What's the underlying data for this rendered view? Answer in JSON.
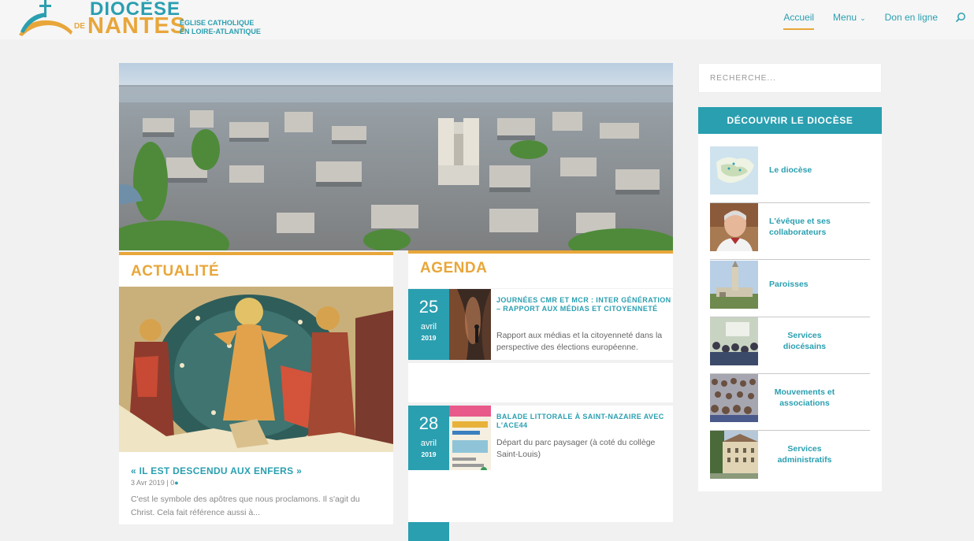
{
  "header": {
    "logo_line1": "DIOCÈSE",
    "logo_de": "DE",
    "logo_line2": "NANTES",
    "logo_sub1": "ÉGLISE CATHOLIQUE",
    "logo_sub2": "EN LOIRE-ATLANTIQUE",
    "nav": {
      "home": "Accueil",
      "menu": "Menu",
      "menu_icon": "chevron-down-icon",
      "donate": "Don en ligne",
      "search_icon": "search-icon"
    }
  },
  "hero": {
    "image": "aerial-city-photo"
  },
  "actualite": {
    "title": "ACTUALITÉ",
    "post_title": "« IL EST DESCENDU AUX ENFERS »",
    "post_date": "3 Avr 2019",
    "post_sep": "|",
    "post_comments": "0",
    "excerpt": "C'est le symbole des apôtres que nous proclamons. Il s'agit du Christ. Cela fait référence aussi à..."
  },
  "agenda": {
    "title": "AGENDA",
    "events": [
      {
        "day": "25",
        "month": "avril",
        "year": "2019",
        "title": "JOURNÉES CMR ET MCR : INTER GÉNÉRATION – RAPPORT AUX MÉDIAS ET CITOYENNETÉ",
        "desc": "Rapport aux médias et la citoyenneté dans la perspective des élections européenne."
      },
      {
        "day": "28",
        "month": "avril",
        "year": "2019",
        "title": "BALADE LITTORALE À SAINT-NAZAIRE AVEC L'ACE44",
        "desc": "Départ du parc paysager (à coté du collège Saint-Louis)"
      }
    ]
  },
  "sidebar": {
    "search_placeholder": "RECHERCHE...",
    "widget_title": "DÉCOUVRIR LE DIOCÈSE",
    "items": [
      {
        "label": "Le diocèse"
      },
      {
        "label": "L'évêque et ses collaborateurs"
      },
      {
        "label": "Paroisses"
      },
      {
        "label": "Services diocésains"
      },
      {
        "label": "Mouvements et associations"
      },
      {
        "label": "Services administratifs"
      }
    ]
  },
  "colors": {
    "teal": "#2a9fb0",
    "orange": "#e8a63a",
    "background": "#f1f1f1"
  }
}
